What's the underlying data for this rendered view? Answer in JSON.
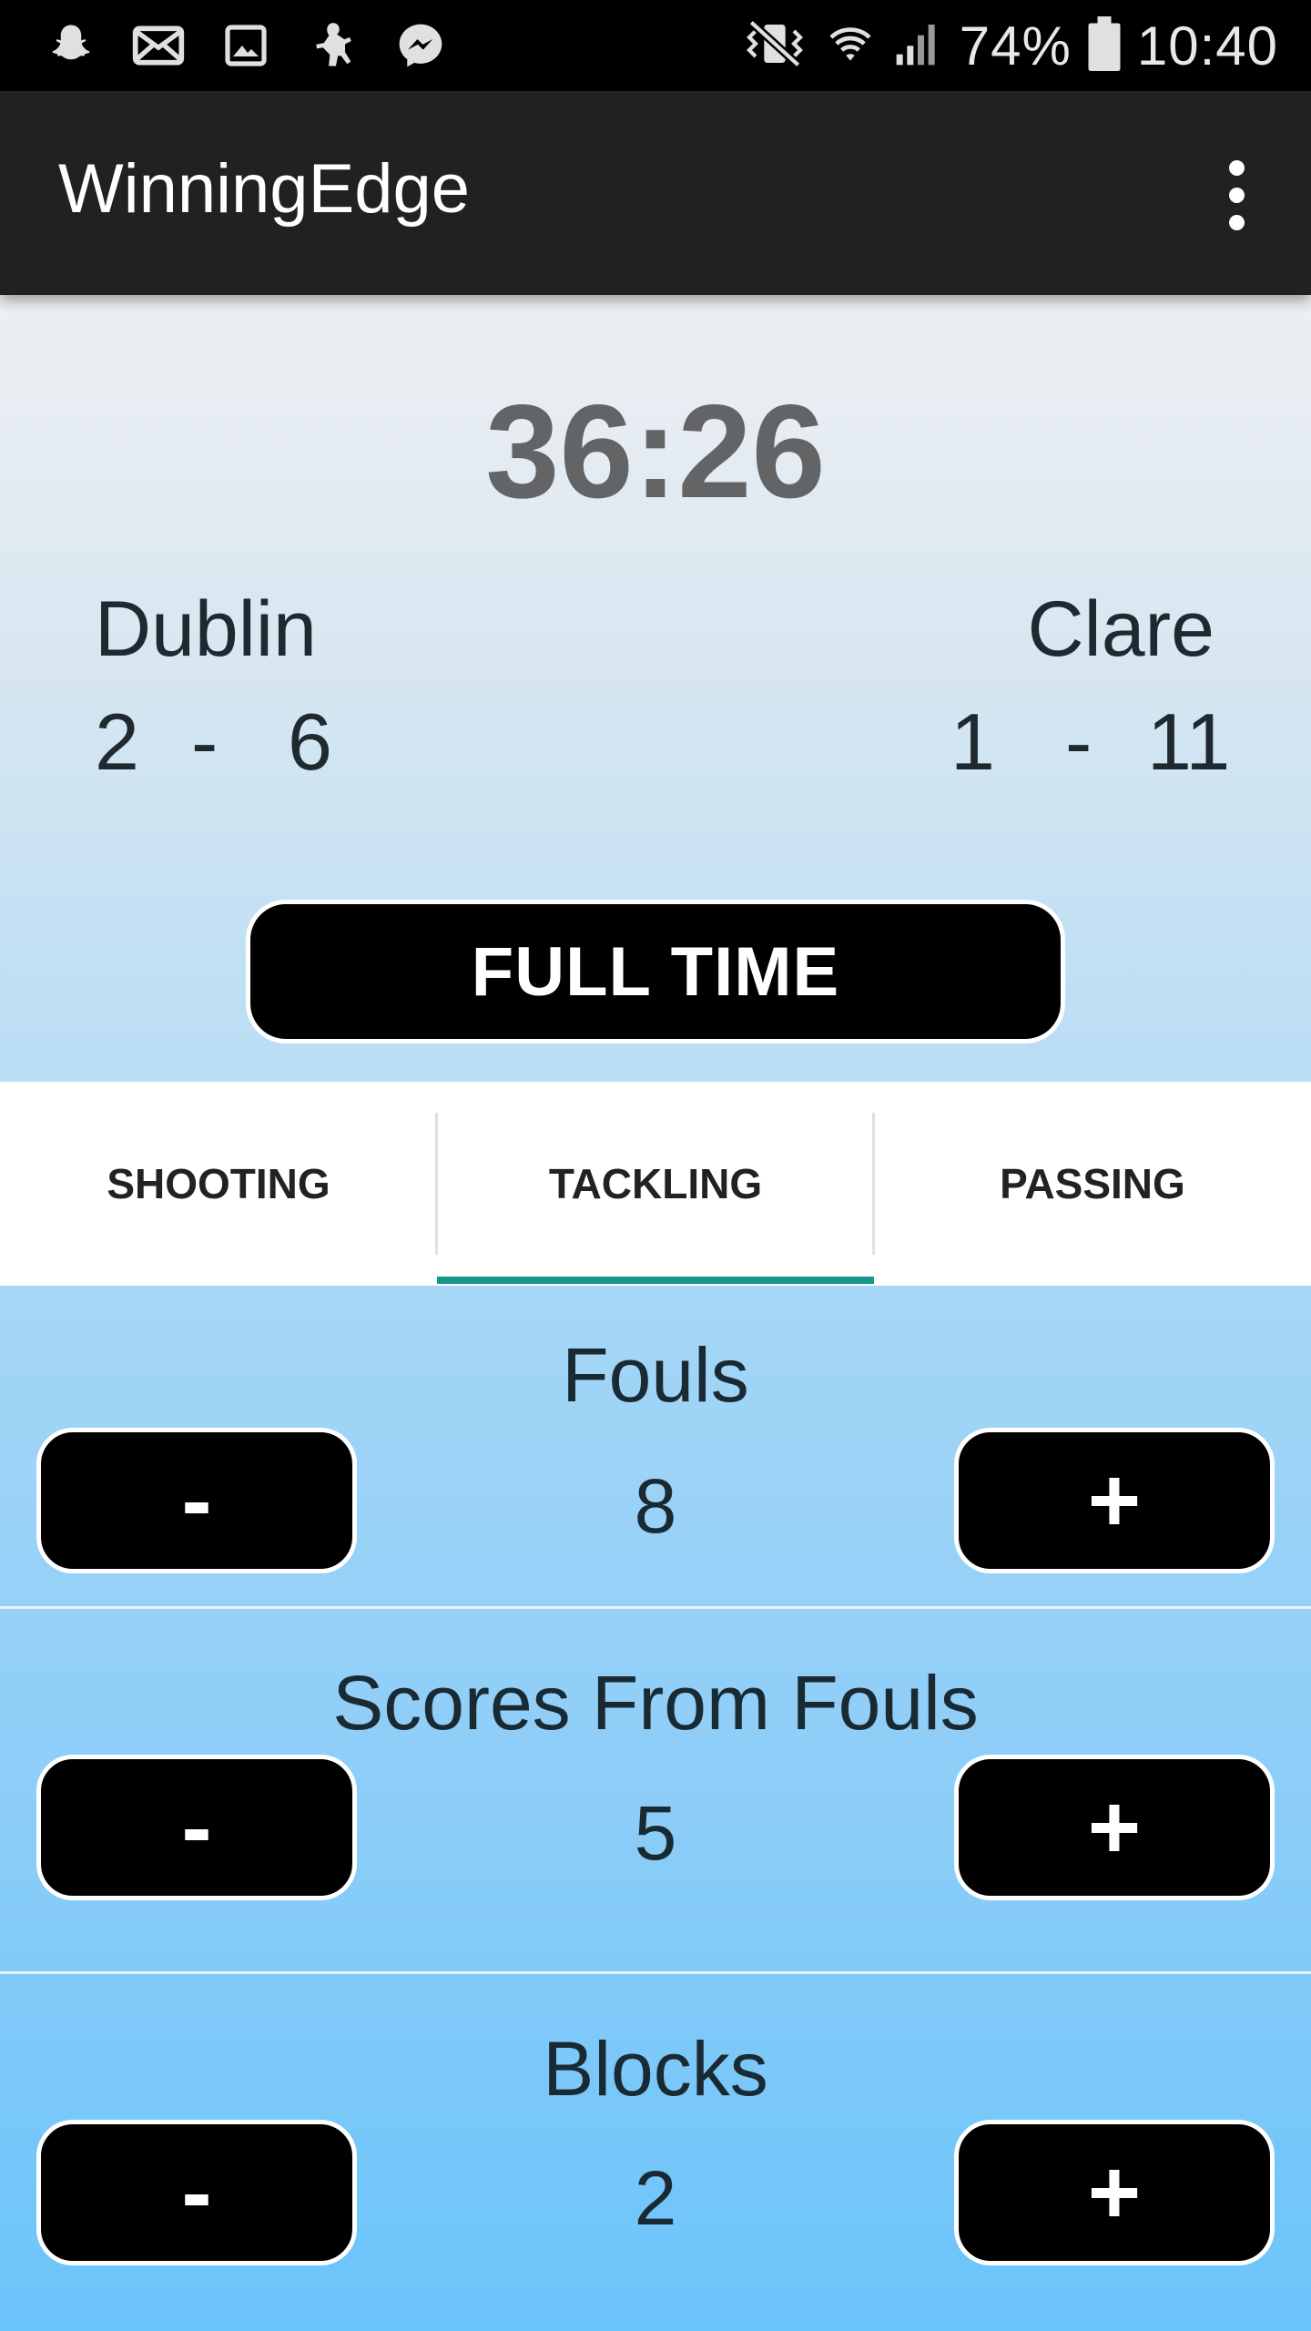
{
  "status_bar": {
    "battery": "74%",
    "time": "10:40",
    "notification_icons": [
      "snapchat-icon",
      "mail-icon",
      "image-icon",
      "app-icon",
      "messenger-icon"
    ],
    "system_icons": [
      "vibrate-icon",
      "wifi-icon",
      "signal-icon",
      "battery-icon"
    ]
  },
  "app_bar": {
    "title": "WinningEdge",
    "menu_icon": "overflow-menu-icon"
  },
  "match": {
    "timer": "36:26",
    "home": {
      "name": "Dublin",
      "goals": "2",
      "separator": "-",
      "points": "6"
    },
    "away": {
      "name": "Clare",
      "goals": "1",
      "separator": "-",
      "points": "11"
    },
    "full_time_label": "FULL TIME"
  },
  "tabs": [
    {
      "label": "SHOOTING",
      "selected": false
    },
    {
      "label": "TACKLING",
      "selected": true
    },
    {
      "label": "PASSING",
      "selected": false
    }
  ],
  "stats": [
    {
      "label": "Fouls",
      "value": "8",
      "minus_label": "-",
      "plus_label": "+"
    },
    {
      "label": "Scores From Fouls",
      "value": "5",
      "minus_label": "-",
      "plus_label": "+"
    },
    {
      "label": "Blocks",
      "value": "2",
      "minus_label": "-",
      "plus_label": "+"
    }
  ],
  "colors": {
    "app_bar": "#212121",
    "accent": "#15988a",
    "button": "#000000",
    "text": "#1f2a30"
  }
}
